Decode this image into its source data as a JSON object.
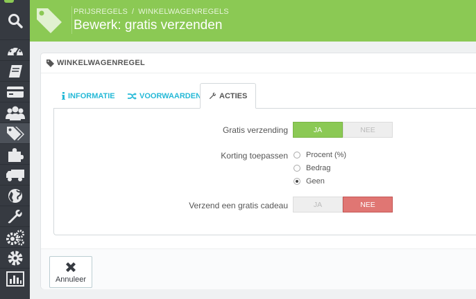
{
  "header": {
    "breadcrumb": [
      "PRIJSREGELS",
      "WINKELWAGENREGELS"
    ],
    "breadcrumb_separator": "/",
    "title": "Bewerk: gratis verzenden",
    "color": "#8bc954"
  },
  "sidebar": {
    "items": [
      {
        "icon": "search-icon"
      },
      {
        "icon": "dashboard-icon"
      },
      {
        "icon": "book-icon"
      },
      {
        "icon": "credit-card-icon"
      },
      {
        "icon": "users-icon"
      },
      {
        "icon": "tags-icon",
        "active": true
      },
      {
        "icon": "puzzle-icon"
      },
      {
        "icon": "truck-icon"
      },
      {
        "icon": "globe-icon"
      },
      {
        "icon": "wrench-icon"
      },
      {
        "icon": "cogs-icon"
      },
      {
        "icon": "gear-icon"
      },
      {
        "icon": "stats-icon"
      }
    ]
  },
  "panel": {
    "heading": "WINKELWAGENREGEL",
    "tabs": [
      {
        "label": "INFORMATIE",
        "icon": "info-icon"
      },
      {
        "label": "VOORWAARDEN",
        "icon": "random-icon"
      },
      {
        "label": "ACTIES",
        "icon": "wrench-icon",
        "active": true
      }
    ],
    "fields": {
      "free_shipping": {
        "label": "Gratis verzending",
        "yes": "JA",
        "no": "NEE",
        "value": "JA"
      },
      "discount": {
        "label": "Korting toepassen",
        "options": [
          "Procent (%)",
          "Bedrag",
          "Geen"
        ],
        "selected": "Geen"
      },
      "free_gift": {
        "label": "Verzend een gratis cadeau",
        "yes": "JA",
        "no": "NEE",
        "value": "NEE"
      }
    },
    "cancel_label": "Annuleer"
  }
}
